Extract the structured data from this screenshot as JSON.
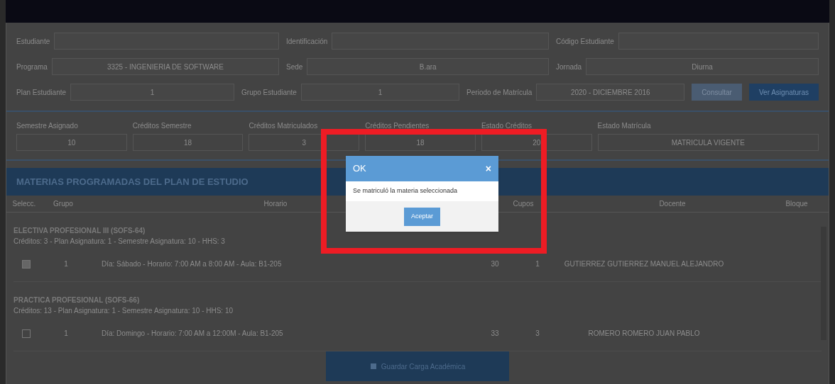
{
  "student": {
    "rows": [
      [
        {
          "label": "Estudiante"
        },
        {
          "label": "Identificación"
        },
        {
          "label": "Código Estudiante"
        }
      ],
      [
        {
          "label": "Programa",
          "value": "3325 - INGENIERIA DE SOFTWARE"
        },
        {
          "label": "Sede",
          "value": "B.ara"
        },
        {
          "label": "Jornada",
          "value": "Diurna"
        }
      ],
      [
        {
          "label": "Plan Estudiante",
          "value": "1"
        },
        {
          "label": "Grupo Estudiante",
          "value": "1"
        },
        {
          "label": "Periodo de Matrícula",
          "value": "2020 - DICIEMBRE 2016"
        }
      ]
    ],
    "buttons": [
      {
        "label": "Consultar",
        "primary": false
      },
      {
        "label": "Ver Asignaturas",
        "primary": true
      }
    ]
  },
  "stats": [
    {
      "label": "Semestre Asignado",
      "value": "10"
    },
    {
      "label": "Créditos Semestre",
      "value": "18"
    },
    {
      "label": "Créditos Matriculados",
      "value": "3"
    },
    {
      "label": "Créditos Pendientes",
      "value": "18"
    },
    {
      "label": "Estado Créditos",
      "value": "20"
    },
    {
      "label": "Estado Matrícula",
      "value": "MATRICULA VIGENTE"
    }
  ],
  "section_title": "MATERIAS PROGRAMADAS DEL PLAN DE ESTUDIO",
  "table": {
    "columns": [
      "Selecc.",
      "Grupo",
      "Horario",
      "Cupos",
      "Docente",
      "Bloque"
    ],
    "groups": [
      {
        "title": "ELECTIVA PROFESIONAL III (SOFS-64)",
        "subtitle": "Créditos: 3 - Plan Asignatura: 1 - Semestre Asignatura: 10 - HHS: 3",
        "rows": [
          {
            "selected": true,
            "group": "1",
            "schedule": "Día: Sábado - Horario: 7:00 AM a 8:00 AM - Aula: B1-205",
            "quota": "30",
            "column_5": "1",
            "teacher": "GUTIERREZ GUTIERREZ MANUEL ALEJANDRO"
          }
        ]
      },
      {
        "title": "PRACTICA PROFESIONAL (SOFS-66)",
        "subtitle": "Créditos: 13 - Plan Asignatura: 1 - Semestre Asignatura: 10 - HHS: 10",
        "rows": [
          {
            "selected": false,
            "group": "1",
            "schedule": "Día: Domingo - Horario: 7:00 AM a 12:00M - Aula: B1-205",
            "quota": "33",
            "column_5": "3",
            "teacher": "ROMERO ROMERO JUAN PABLO"
          }
        ]
      }
    ]
  },
  "save_button": "Guardar Carga Académica",
  "dialog": {
    "title": "OK",
    "close": "×",
    "message": "Se matriculó la materia seleccionada",
    "button": "Aceptar"
  }
}
